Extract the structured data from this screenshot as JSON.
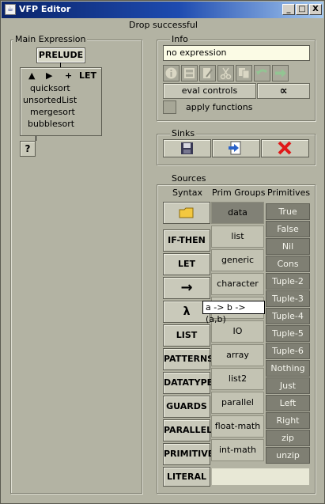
{
  "window": {
    "title": "VFP Editor",
    "controls": [
      "_",
      "□",
      "X"
    ]
  },
  "status": "Drop successful",
  "main_expression": {
    "label": "Main Expression",
    "prelude_label": "PRELUDE",
    "toolbar": [
      "▲",
      "▶",
      "+",
      "LET"
    ],
    "functions": [
      "quicksort",
      "unsortedList",
      "mergesort",
      "bubblesort"
    ],
    "help_button": "?"
  },
  "info": {
    "label": "Info",
    "expression_value": "no expression",
    "tool_icons": [
      "info-icon",
      "layout-icon",
      "edit-icon",
      "scissors-icon",
      "copy-icon",
      "undo-icon",
      "redo-icon"
    ],
    "eval_controls_label": "eval controls",
    "alpha_label": "∝",
    "apply_functions_label": "apply functions"
  },
  "sinks": {
    "label": "Sinks",
    "icons": [
      "save-icon",
      "export-icon",
      "delete-icon"
    ]
  },
  "sources": {
    "label": "Sources",
    "columns": {
      "syntax": "Syntax",
      "prim_groups": "Prim Groups",
      "primitives": "Primitives"
    },
    "syntax": [
      "folder-icon",
      "IF-THEN",
      "LET",
      "→",
      "λ",
      "LIST",
      "PATTERNS",
      "DATATYPE",
      "GUARDS",
      "PARALLEL",
      "PRIMITIVE",
      "LITERAL"
    ],
    "prim_groups": [
      "data",
      "list",
      "generic",
      "character",
      "",
      "IO",
      "array",
      "list2",
      "parallel",
      "float-math",
      "int-math"
    ],
    "primitives": [
      "True",
      "False",
      "Nil",
      "Cons",
      "Tuple-2",
      "Tuple-3",
      "Tuple-4",
      "Tuple-5",
      "Tuple-6",
      "Nothing",
      "Just",
      "Left",
      "Right",
      "zip",
      "unzip"
    ],
    "tooltip": "a -> b -> (a,b)"
  },
  "colors": {
    "title_gradient_start": "#0a246a",
    "title_gradient_end": "#a6caf0",
    "background": "#b3b3a3",
    "selected_group": "#818176",
    "primitive_bg": "#7f7f73",
    "delete_icon": "#e01818"
  }
}
